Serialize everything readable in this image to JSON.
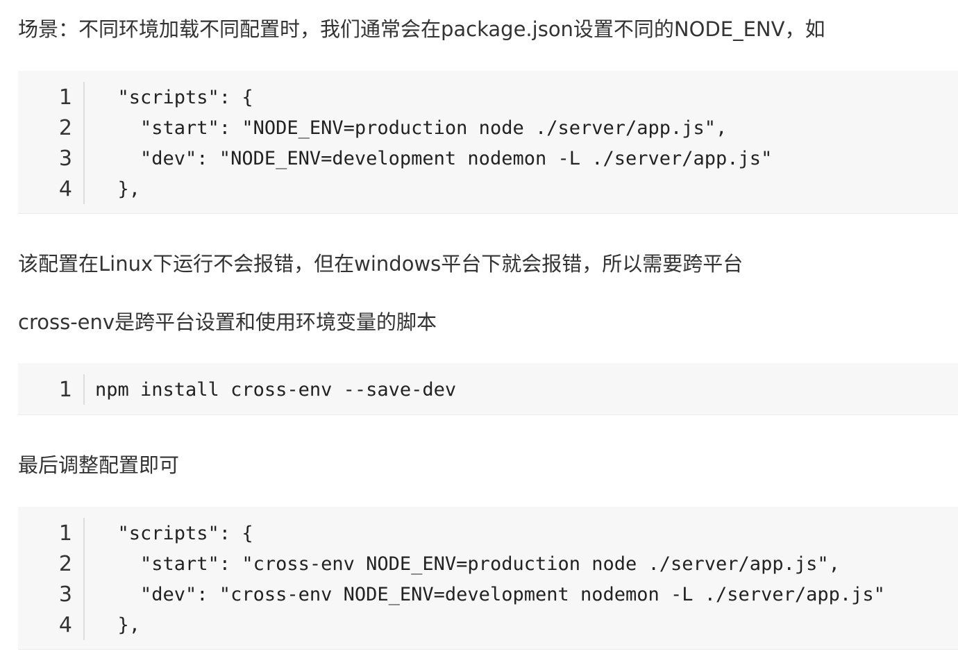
{
  "para1": "场景：不同环境加载不同配置时，我们通常会在package.json设置不同的NODE_ENV，如",
  "code1": {
    "line_numbers": [
      "1",
      "2",
      "3",
      "4"
    ],
    "lines": [
      "  \"scripts\": {",
      "    \"start\": \"NODE_ENV=production node ./server/app.js\",",
      "    \"dev\": \"NODE_ENV=development nodemon -L ./server/app.js\"",
      "  },"
    ]
  },
  "para2": "该配置在Linux下运行不会报错，但在windows平台下就会报错，所以需要跨平台",
  "para3": "cross-env是跨平台设置和使用环境变量的脚本",
  "code2": {
    "line_numbers": [
      "1"
    ],
    "lines": [
      "npm install cross-env --save-dev"
    ]
  },
  "para4": "最后调整配置即可",
  "code3": {
    "line_numbers": [
      "1",
      "2",
      "3",
      "4"
    ],
    "lines": [
      "  \"scripts\": {",
      "    \"start\": \"cross-env NODE_ENV=production node ./server/app.js\",",
      "    \"dev\": \"cross-env NODE_ENV=development nodemon -L ./server/app.js\"",
      "  },"
    ]
  }
}
